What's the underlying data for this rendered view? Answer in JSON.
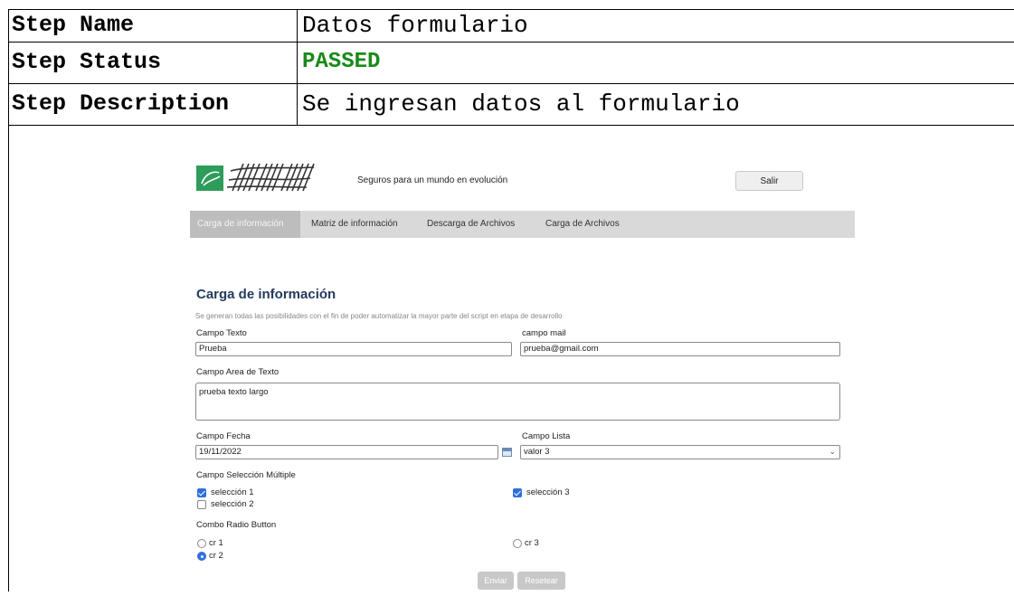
{
  "report": {
    "rows": [
      {
        "label": "Step Name",
        "value": "Datos formulario"
      },
      {
        "label": "Step Status",
        "value": "PASSED"
      },
      {
        "label": "Step Description",
        "value": "Se ingresan datos al formulario"
      }
    ],
    "status_color": "#1a8a1a"
  },
  "app": {
    "tagline": "Seguros para un mundo en evolución",
    "salir_label": "Salir",
    "nav": [
      {
        "label": "Carga de información",
        "active": true
      },
      {
        "label": "Matriz de información",
        "active": false
      },
      {
        "label": "Descarga de Archivos",
        "active": false
      },
      {
        "label": "Carga de Archivos",
        "active": false
      }
    ],
    "page_title": "Carga de información",
    "subtitle": "Se generan todas las posibilidades con el fin de poder automatizar la mayor parte del script en etapa de desarrollo",
    "form": {
      "campo_texto_label": "Campo Texto",
      "campo_texto_value": "Prueba",
      "campo_mail_label": "campo mail",
      "campo_mail_value": "prueba@gmail.com",
      "area_texto_label": "Campo Area de Texto",
      "area_texto_value": "prueba texto largo",
      "fecha_label": "Campo Fecha",
      "fecha_value": "19/11/2022",
      "lista_label": "Campo Lista",
      "lista_value": "valor 3",
      "multi_label": "Campo Selección Múltiple",
      "checkboxes": [
        {
          "label": "selección 1",
          "checked": true
        },
        {
          "label": "selección 2",
          "checked": false
        },
        {
          "label": "selección 3",
          "checked": true
        }
      ],
      "radio_label": "Combo Radio Button",
      "radios": [
        {
          "label": "cr 1",
          "selected": false
        },
        {
          "label": "cr 2",
          "selected": true
        },
        {
          "label": "cr 3",
          "selected": false
        }
      ],
      "enviar_label": "Enviar",
      "resetear_label": "Resetear"
    },
    "accent_color": "#243b5e"
  }
}
